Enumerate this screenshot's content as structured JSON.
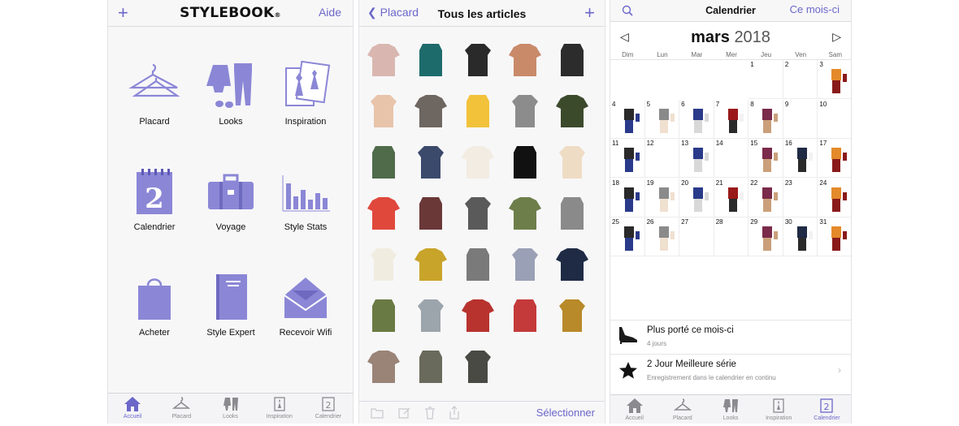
{
  "home": {
    "plus_label": "+",
    "logo_text": "STYLEBOOK",
    "logo_mark": "®",
    "help_label": "Aide",
    "tiles": [
      {
        "label": "Placard",
        "icon": "hanger-icon"
      },
      {
        "label": "Looks",
        "icon": "outfit-icon"
      },
      {
        "label": "Inspiration",
        "icon": "inspiration-icon"
      },
      {
        "label": "Calendrier",
        "icon": "calendar-icon"
      },
      {
        "label": "Voyage",
        "icon": "suitcase-icon"
      },
      {
        "label": "Style Stats",
        "icon": "bar-chart-icon"
      },
      {
        "label": "Acheter",
        "icon": "shopping-bag-icon"
      },
      {
        "label": "Style Expert",
        "icon": "book-icon"
      },
      {
        "label": "Recevoir Wifi",
        "icon": "envelope-icon"
      }
    ]
  },
  "tabs": [
    {
      "label": "Accueil",
      "icon": "home-icon"
    },
    {
      "label": "Placard",
      "icon": "hanger-icon"
    },
    {
      "label": "Looks",
      "icon": "outfit-icon"
    },
    {
      "label": "Inspiration",
      "icon": "inspiration-icon"
    },
    {
      "label": "Calendrier",
      "icon": "calendar-icon"
    }
  ],
  "closet": {
    "back_label": "Placard",
    "title": "Tous les articles",
    "plus_label": "+",
    "select_label": "Sélectionner",
    "garment_colors": [
      "#d9b7b0",
      "#1e6b6b",
      "#2a2a2a",
      "#c98a6a",
      "#2c2c2c",
      "#e8c4aa",
      "#6e6660",
      "#f2c23a",
      "#8c8c8c",
      "#3c4a2c",
      "#4f6b4a",
      "#3b4a6b",
      "#f2ece2",
      "#111111",
      "#efdcc4",
      "#e0483c",
      "#6b3838",
      "#5a5a5a",
      "#6e7e4a",
      "#8a8a8a",
      "#f1ece0",
      "#c9a42a",
      "#7a7a7a",
      "#9aa0b5",
      "#1f2a44",
      "#6a7a44",
      "#9ca4ac",
      "#b8332e",
      "#c43a3a",
      "#b88a2a",
      "#9a8478",
      "#6a6a5c",
      "#4a4a44"
    ]
  },
  "calendar": {
    "search_icon": "search-icon",
    "title": "Calendrier",
    "this_month_label": "Ce mois-ci",
    "month": "mars",
    "year": "2018",
    "days_of_week": [
      "Dim",
      "Lun",
      "Mar",
      "Mer",
      "Jeu",
      "Ven",
      "Sam"
    ],
    "days": [
      "1",
      "2",
      "3",
      "4",
      "5",
      "6",
      "7",
      "8",
      "9",
      "10",
      "11",
      "12",
      "13",
      "14",
      "15",
      "16",
      "17",
      "18",
      "19",
      "20",
      "21",
      "22",
      "23",
      "24",
      "25",
      "26",
      "27",
      "28",
      "29",
      "30",
      "31"
    ],
    "stats": [
      {
        "title": "Plus porté ce mois-ci",
        "subtitle": "4 jours",
        "icon": "shoe-icon"
      },
      {
        "title": "2 Jour Meilleure série",
        "subtitle": "Enregistrement dans le calendrier en continu",
        "icon": "star-icon"
      }
    ]
  },
  "colors": {
    "accent": "#6b67c9",
    "icon_fill": "#8b87d6"
  }
}
